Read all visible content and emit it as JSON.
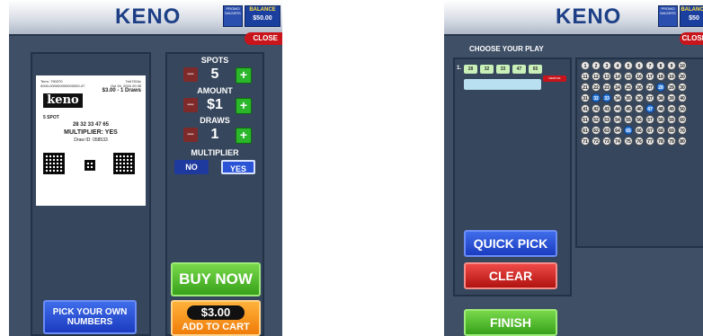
{
  "left": {
    "header": {
      "title": "KENO",
      "balance_label": "BALANCE",
      "balance_value": "$50.00",
      "promo_label": "PROMO WAGERS",
      "close_label": "CLOSE"
    },
    "ticket": {
      "term": "Term: 790370",
      "code": "7eb7204c",
      "serial": "0000-000000000000000-47",
      "date": "Oct 16, 2016 20:35",
      "price": "$3.00 - 1 Draws",
      "logo": "keno",
      "spot": "5 SPOT",
      "numbers": "28 32 33 47 65",
      "multiplier": "MULTIPLIER: YES",
      "draw_id": "Draw ID: 058533"
    },
    "controls": {
      "spots_label": "SPOTS",
      "spots_value": "5",
      "amount_label": "AMOUNT",
      "amount_value": "$1",
      "draws_label": "DRAWS",
      "draws_value": "1",
      "multiplier_label": "MULTIPLIER",
      "no_label": "NO",
      "yes_label": "YES"
    },
    "pick_button": "PICK YOUR OWN NUMBERS",
    "buy_button": "BUY NOW",
    "cart_amount": "$3.00",
    "cart_label": "ADD TO CART"
  },
  "right": {
    "header": {
      "title": "KENO",
      "balance_label": "BALANCE",
      "balance_value": "$50",
      "promo_label": "PROMO WAGERS",
      "close_label": "CLOSE"
    },
    "choose_label": "CHOOSE YOUR PLAY",
    "row_index": "1.",
    "picks": [
      "28",
      "32",
      "33",
      "47",
      "65"
    ],
    "remove_label": "REMOVE",
    "quick_pick": "QUICK PICK",
    "clear": "CLEAR",
    "finish": "FINISH",
    "board_numbers": [
      "1",
      "2",
      "3",
      "4",
      "5",
      "6",
      "7",
      "8",
      "9",
      "10",
      "11",
      "12",
      "13",
      "14",
      "15",
      "16",
      "17",
      "18",
      "19",
      "20",
      "21",
      "22",
      "23",
      "24",
      "25",
      "26",
      "27",
      "28",
      "29",
      "30",
      "31",
      "32",
      "33",
      "34",
      "35",
      "36",
      "37",
      "38",
      "39",
      "40",
      "41",
      "42",
      "43",
      "44",
      "45",
      "46",
      "47",
      "48",
      "49",
      "50",
      "51",
      "52",
      "53",
      "54",
      "55",
      "56",
      "57",
      "58",
      "59",
      "60",
      "61",
      "62",
      "63",
      "64",
      "65",
      "66",
      "67",
      "68",
      "69",
      "70",
      "71",
      "72",
      "73",
      "74",
      "75",
      "76",
      "77",
      "78",
      "79",
      "80"
    ],
    "selected_numbers": [
      "28",
      "32",
      "33",
      "47",
      "65"
    ]
  }
}
